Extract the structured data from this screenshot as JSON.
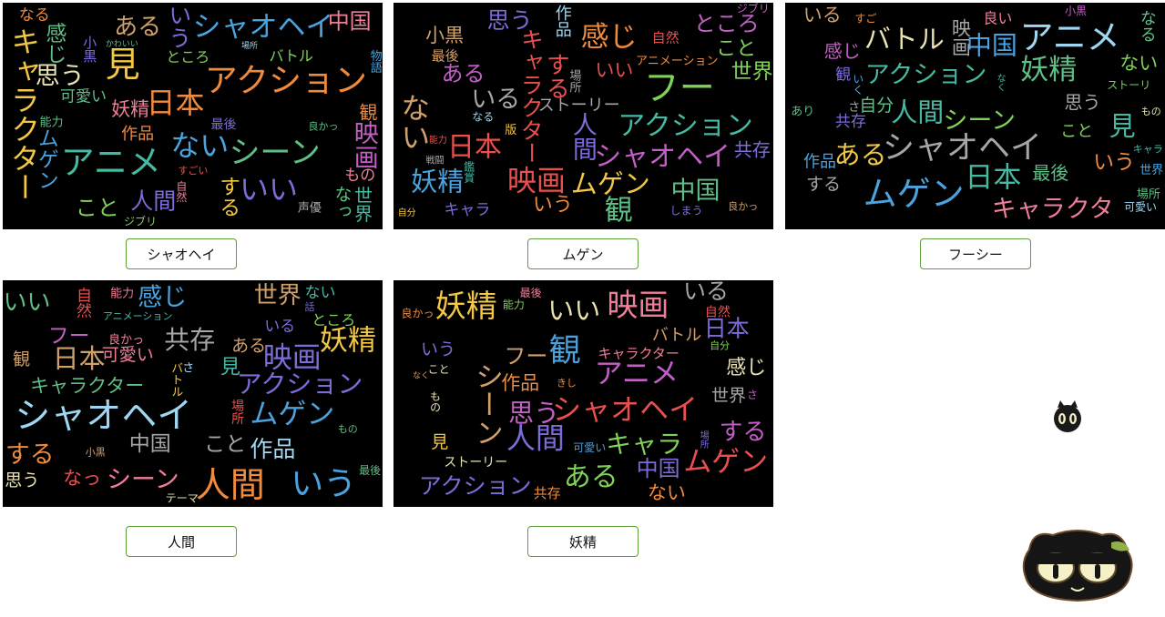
{
  "clouds": [
    {
      "id": "shaohei",
      "button_label": "シャオヘイ",
      "words": [
        "アニメ",
        "見",
        "シャオヘイ",
        "アクション",
        "いい",
        "日本",
        "ない",
        "ある",
        "シーン",
        "思う",
        "映画",
        "キャラクター",
        "する",
        "いう",
        "感じ",
        "人間",
        "こと",
        "中国",
        "観",
        "ムゲン",
        "妖精",
        "なる",
        "作品",
        "なっ",
        "世界",
        "可愛い",
        "小黒",
        "ところ",
        "もの",
        "バトル",
        "最後",
        "すごい",
        "声優",
        "ジブリ",
        "物語",
        "かわいい",
        "良かっ",
        "自然",
        "能力",
        "場所"
      ]
    },
    {
      "id": "mugen",
      "button_label": "ムゲン",
      "words": [
        "シャオヘイ",
        "フー",
        "観",
        "映画",
        "アクション",
        "感じ",
        "ない",
        "人間",
        "妖精",
        "中国",
        "いる",
        "日本",
        "ムゲン",
        "する",
        "ある",
        "こと",
        "いう",
        "いい",
        "キャラクター",
        "思う",
        "ところ",
        "世界",
        "共存",
        "小黒",
        "自然",
        "作品",
        "ストーリー",
        "アニメーション",
        "キャラ",
        "最後",
        "版",
        "なる",
        "良かっ",
        "自分",
        "場所",
        "能力",
        "ジブリ",
        "戦闘",
        "しまう",
        "鑑賞"
      ]
    },
    {
      "id": "fushi",
      "button_label": "フーシー",
      "words": [
        "シャオヘイ",
        "人間",
        "妖精",
        "ムゲン",
        "アニメ",
        "バトル",
        "日本",
        "中国",
        "アクション",
        "キャラクタ",
        "見",
        "ある",
        "シーン",
        "いう",
        "映画",
        "感じ",
        "思う",
        "する",
        "いる",
        "なる",
        "ない",
        "観",
        "こと",
        "最後",
        "共存",
        "作品",
        "自分",
        "良い",
        "世界",
        "小黒",
        "場所",
        "可愛い",
        "キャラ",
        "なく",
        "あり",
        "もの",
        "さ",
        "ストーリ",
        "いく",
        "すご"
      ]
    },
    {
      "id": "ningen",
      "button_label": "人間",
      "words": [
        "シャオヘイ",
        "ムゲン",
        "妖精",
        "人間",
        "いう",
        "共存",
        "いい",
        "する",
        "アクション",
        "日本",
        "映画",
        "世界",
        "中国",
        "感じ",
        "シーン",
        "見",
        "フー",
        "作品",
        "こと",
        "思う",
        "観",
        "ある",
        "ない",
        "なっ",
        "キャラクター",
        "可愛い",
        "いる",
        "ところ",
        "自然",
        "場所",
        "良かっ",
        "能力",
        "最後",
        "話",
        "もの",
        "小黒",
        "さ",
        "バトル",
        "アニメーション",
        "テーマ"
      ]
    },
    {
      "id": "yousei",
      "button_label": "妖精",
      "words": [
        "シャオヘイ",
        "人間",
        "ムゲン",
        "妖精",
        "いい",
        "映画",
        "観",
        "する",
        "ある",
        "フー",
        "シーン",
        "アニメ",
        "思う",
        "キャラ",
        "日本",
        "中国",
        "アクション",
        "いる",
        "ない",
        "いう",
        "見",
        "作品",
        "感じ",
        "世界",
        "共存",
        "バトル",
        "キャラクター",
        "自然",
        "ストーリー",
        "可愛い",
        "さ",
        "こと",
        "最後",
        "場所",
        "なく",
        "良かっ",
        "自分",
        "きし",
        "能力",
        "もの"
      ]
    }
  ],
  "palette": [
    "#e94f4f",
    "#f08a3c",
    "#f2c744",
    "#7fd15a",
    "#46b9a3",
    "#4aa3df",
    "#7d6cd8",
    "#c35fc6",
    "#e8e2b0",
    "#a6a6a6",
    "#ef7f98",
    "#9fd7f2",
    "#5fbf86",
    "#d0a06a"
  ],
  "icons": {
    "small_mascot": "cat-face-icon",
    "big_mascot": "black-cat-mascot-icon"
  }
}
